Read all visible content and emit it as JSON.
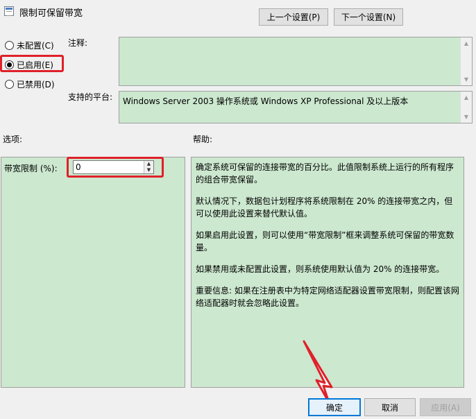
{
  "window": {
    "title": "限制可保留带宽"
  },
  "nav": {
    "prev_label": "上一个设置(P)",
    "next_label": "下一个设置(N)"
  },
  "state": {
    "options": [
      {
        "label": "未配置(C)",
        "checked": false
      },
      {
        "label": "已启用(E)",
        "checked": true
      },
      {
        "label": "已禁用(D)",
        "checked": false
      }
    ]
  },
  "comment": {
    "label": "注释:",
    "value": ""
  },
  "platform": {
    "label": "支持的平台:",
    "value": "Windows Server 2003 操作系统或 Windows XP Professional 及以上版本"
  },
  "options_section": {
    "label": "选项:",
    "bandwidth_label": "带宽限制 (%):",
    "bandwidth_value": "0"
  },
  "help": {
    "label": "帮助:",
    "paragraphs": [
      "确定系统可保留的连接带宽的百分比。此值限制系统上运行的所有程序的组合带宽保留。",
      "默认情况下，数据包计划程序将系统限制在 20% 的连接带宽之内，但可以使用此设置来替代默认值。",
      "如果启用此设置，则可以使用“带宽限制”框来调整系统可保留的带宽数量。",
      "如果禁用或未配置此设置，则系统使用默认值为 20% 的连接带宽。",
      "重要信息: 如果在注册表中为特定网络适配器设置带宽限制，则配置该网络适配器时就会忽略此设置。"
    ]
  },
  "footer": {
    "ok_label": "确定",
    "cancel_label": "取消",
    "apply_label": "应用(A)"
  },
  "colors": {
    "panel_bg": "#cce8cf",
    "highlight_red": "#e0202a",
    "focus_blue": "#0078d7"
  }
}
